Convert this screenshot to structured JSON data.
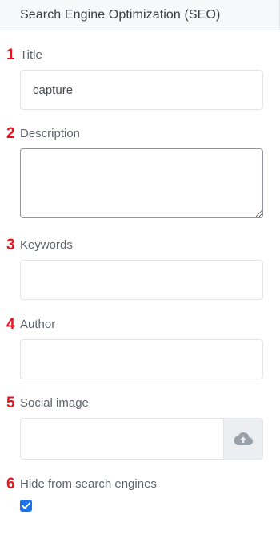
{
  "header": {
    "title": "Search Engine Optimization (SEO)"
  },
  "fields": {
    "title": {
      "number": "1",
      "label": "Title",
      "value": "capture"
    },
    "description": {
      "number": "2",
      "label": "Description",
      "value": ""
    },
    "keywords": {
      "number": "3",
      "label": "Keywords",
      "value": ""
    },
    "author": {
      "number": "4",
      "label": "Author",
      "value": ""
    },
    "social_image": {
      "number": "5",
      "label": "Social image",
      "value": "",
      "upload_icon": "cloud-upload-icon"
    },
    "hide_from_search": {
      "number": "6",
      "label": "Hide from search engines",
      "checked": true
    }
  },
  "colors": {
    "marker": "#e8141e",
    "checkbox": "#1a73e8",
    "upload_button_bg": "#eceef1",
    "upload_icon": "#9aa0a8"
  }
}
